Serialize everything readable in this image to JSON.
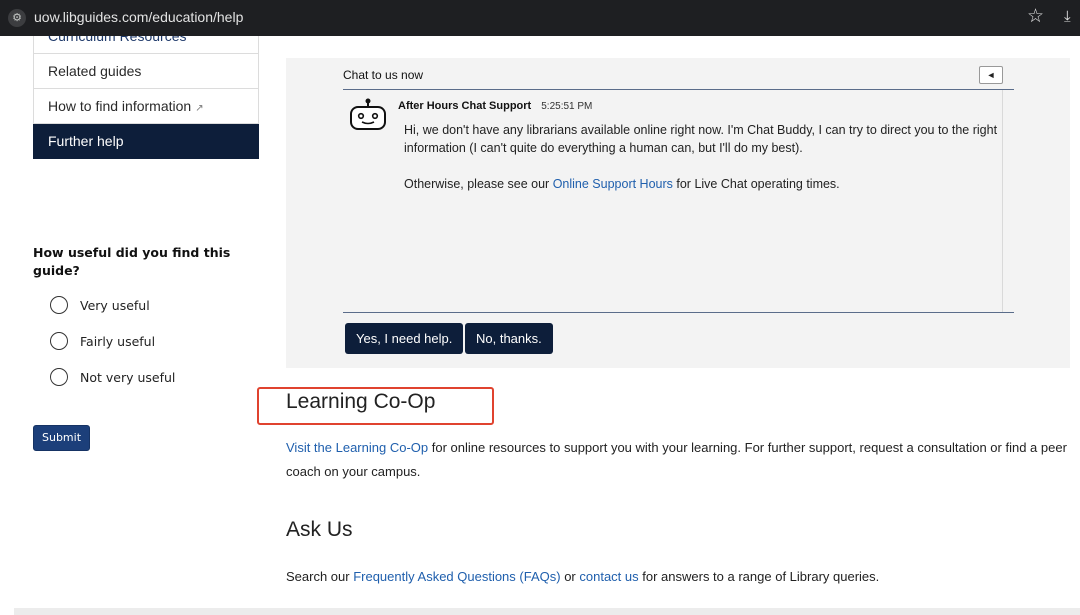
{
  "browser": {
    "url": "uow.libguides.com/education/help",
    "site_settings_icon": "tune-icon",
    "bookmark_icon": "star-icon",
    "download_icon": "download-icon"
  },
  "sidebar": {
    "items": [
      {
        "label": "Curriculum Resources"
      },
      {
        "label": "Related guides"
      },
      {
        "label": "How to find information"
      },
      {
        "label": "Further help"
      }
    ]
  },
  "feedback": {
    "question": "How useful did you find this guide?",
    "options": [
      "Very useful",
      "Fairly useful",
      "Not very useful"
    ],
    "submit_label": "Submit"
  },
  "chat": {
    "header": "Chat to us now",
    "collapse_glyph": "◄",
    "message": {
      "sender": "After Hours Chat Support",
      "time": "5:25:51 PM",
      "paragraph1": "Hi, we don't have any librarians available online right now. I'm Chat Buddy, I can try to direct you to the right information (I can't quite do everything a human can, but I'll do my best).",
      "paragraph2_before": "Otherwise, please see our ",
      "paragraph2_link": "Online Support Hours",
      "paragraph2_after": " for Live Chat operating times."
    },
    "yes_label": "Yes, I need help.",
    "no_label": "No, thanks."
  },
  "learning_coop": {
    "title": "Learning Co-Op",
    "link": "Visit the Learning Co-Op",
    "text": " for online resources to support you with your learning. For further support, request a consultation or find a peer coach on your campus."
  },
  "ask_us": {
    "title": "Ask Us",
    "before": "Search our ",
    "link1": "Frequently Asked Questions (FAQs)",
    "middle": " or ",
    "link2": "contact us",
    "after": " for answers to a range of Library queries."
  },
  "colors": {
    "nav_active": "#0d1e3a",
    "link": "#1f5fad",
    "highlight": "#e0432f",
    "submit": "#1c3f7a"
  }
}
